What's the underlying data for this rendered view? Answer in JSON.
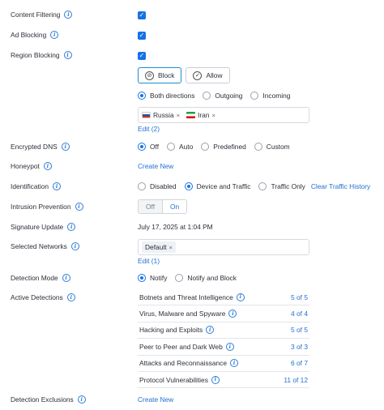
{
  "content_filtering": {
    "label": "Content Filtering"
  },
  "ad_blocking": {
    "label": "Ad Blocking"
  },
  "region_blocking": {
    "label": "Region Blocking",
    "block_label": "Block",
    "allow_label": "Allow",
    "directions": [
      "Both directions",
      "Outgoing",
      "Incoming"
    ],
    "selected_direction": "Both directions",
    "regions": [
      "Russia",
      "Iran"
    ],
    "edit_label": "Edit (2)"
  },
  "encrypted_dns": {
    "label": "Encrypted DNS",
    "options": [
      "Off",
      "Auto",
      "Predefined",
      "Custom"
    ],
    "selected": "Off"
  },
  "honeypot": {
    "label": "Honeypot",
    "action": "Create New"
  },
  "identification": {
    "label": "Identification",
    "options": [
      "Disabled",
      "Device and Traffic",
      "Traffic Only"
    ],
    "selected": "Device and Traffic",
    "clear_label": "Clear Traffic History"
  },
  "intrusion_prevention": {
    "label": "Intrusion Prevention",
    "off_label": "Off",
    "on_label": "On",
    "state": "On"
  },
  "signature_update": {
    "label": "Signature Update",
    "value": "July 17, 2025 at 1:04 PM"
  },
  "selected_networks": {
    "label": "Selected Networks",
    "networks": [
      "Default"
    ],
    "edit_label": "Edit (1)"
  },
  "detection_mode": {
    "label": "Detection Mode",
    "options": [
      "Notify",
      "Notify and Block"
    ],
    "selected": "Notify"
  },
  "active_detections": {
    "label": "Active Detections",
    "rows": [
      {
        "name": "Botnets and Threat Intelligence",
        "count": "5 of 5"
      },
      {
        "name": "Virus, Malware and Spyware",
        "count": "4 of 4"
      },
      {
        "name": "Hacking and Exploits",
        "count": "5 of 5"
      },
      {
        "name": "Peer to Peer and Dark Web",
        "count": "3 of 3"
      },
      {
        "name": "Attacks and Reconnaissance",
        "count": "6 of 7"
      },
      {
        "name": "Protocol Vulnerabilities",
        "count": "11 of 12"
      }
    ]
  },
  "detection_exclusions": {
    "label": "Detection Exclusions",
    "action": "Create New"
  },
  "colors": {
    "accent": "#1672e6",
    "link": "#1f6fd1",
    "text": "#2b2f38"
  },
  "icons": {
    "info": "info-icon",
    "check": "checkmark-icon",
    "block": "block-icon",
    "allow": "allow-check-icon",
    "remove": "close-icon"
  }
}
